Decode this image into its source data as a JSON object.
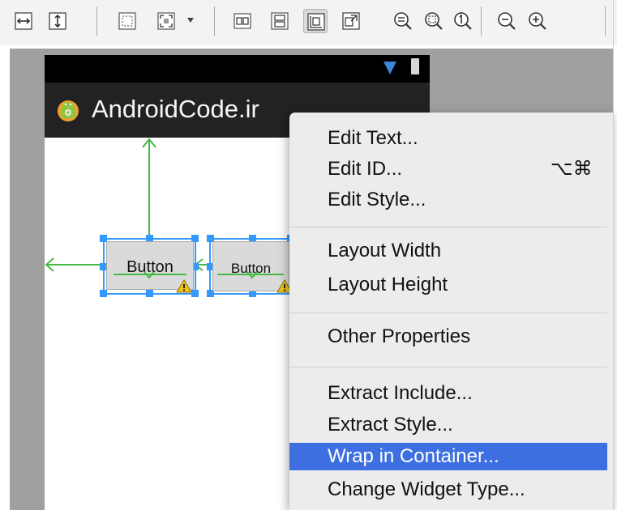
{
  "toolbar": {
    "buttons": [
      {
        "name": "fill-width-icon",
        "pressed": false
      },
      {
        "name": "fill-height-icon",
        "pressed": false
      },
      {
        "name": "show-margins-icon",
        "pressed": false
      },
      {
        "name": "image-resize-icon",
        "pressed": false,
        "has_dropdown": true
      },
      {
        "name": "distribute-horizontal-icon",
        "pressed": false
      },
      {
        "name": "distribute-vertical-icon",
        "pressed": false
      },
      {
        "name": "align-baseline-icon",
        "pressed": true
      },
      {
        "name": "layout-toggle-icon",
        "pressed": false
      },
      {
        "name": "zoom-to-fit-icon",
        "pressed": false
      },
      {
        "name": "zoom-real-size-icon",
        "pressed": false
      },
      {
        "name": "zoom-100-icon",
        "pressed": false
      },
      {
        "name": "zoom-out-icon",
        "pressed": false
      },
      {
        "name": "zoom-in-icon",
        "pressed": false
      }
    ]
  },
  "device": {
    "status_bar_icons": [
      "signal-icon",
      "battery-icon"
    ],
    "app_title": "AndroidCode.ir",
    "app_icon": "android-icon"
  },
  "layout": {
    "buttons": [
      {
        "label": "Button",
        "has_warning": true
      },
      {
        "label": "Button",
        "has_warning": true
      }
    ]
  },
  "context_menu": {
    "groups": [
      [
        {
          "label": "Edit Text...",
          "shortcut": ""
        },
        {
          "label": "Edit ID...",
          "shortcut": "⌥⌘"
        },
        {
          "label": "Edit Style...",
          "shortcut": ""
        }
      ],
      [
        {
          "label": "Layout Width",
          "shortcut": ""
        },
        {
          "label": "Layout Height",
          "shortcut": ""
        }
      ],
      [
        {
          "label": "Other Properties",
          "shortcut": ""
        }
      ],
      [
        {
          "label": "Extract Include...",
          "shortcut": ""
        },
        {
          "label": "Extract Style...",
          "shortcut": ""
        },
        {
          "label": "Wrap in Container...",
          "shortcut": "",
          "selected": true
        },
        {
          "label": "Change Widget Type...",
          "shortcut": ""
        }
      ]
    ]
  },
  "colors": {
    "selection_highlight": "#3d6fe0",
    "guide_line": "#44bb44",
    "selection_handle": "#3399ff",
    "action_bar": "#222222",
    "canvas_background": "#a0a0a0"
  }
}
